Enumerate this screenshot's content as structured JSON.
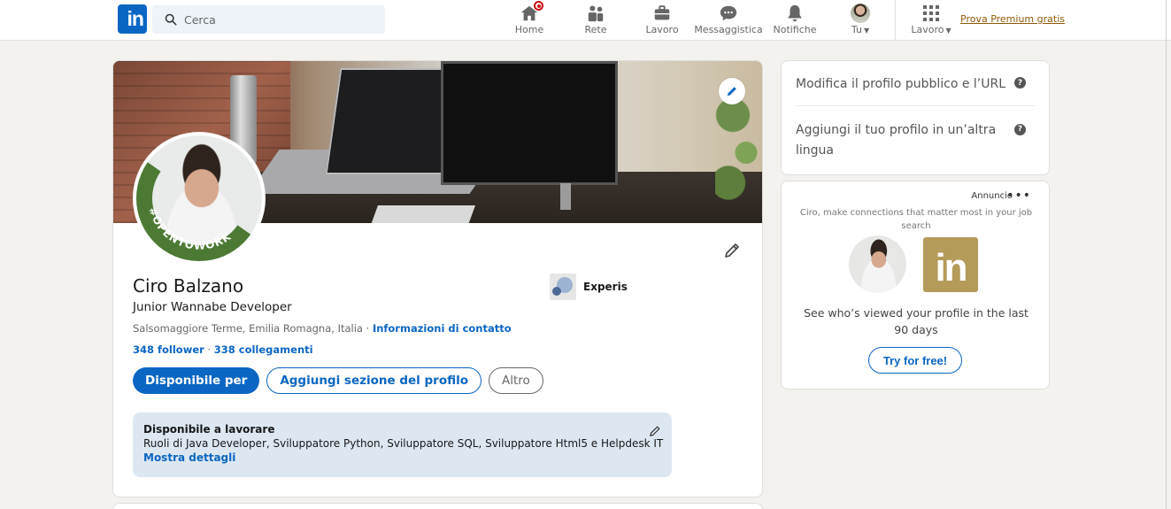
{
  "nav": {
    "search_placeholder": "Cerca",
    "items": [
      {
        "label": "Home",
        "icon": "home-icon"
      },
      {
        "label": "Rete",
        "icon": "network-icon"
      },
      {
        "label": "Lavoro",
        "icon": "briefcase-icon"
      },
      {
        "label": "Messaggistica",
        "icon": "messaging-icon"
      },
      {
        "label": "Notifiche",
        "icon": "bell-icon"
      },
      {
        "label": "Tu",
        "icon": "avatar"
      },
      {
        "label": "Lavoro",
        "icon": "grid-icon"
      }
    ],
    "premium_link": "Prova Premium gratis"
  },
  "profile": {
    "name": "Ciro Balzano",
    "headline": "Junior Wannabe Developer",
    "location": "Salsomaggiore Terme, Emilia Romagna, Italia",
    "location_sep": " · ",
    "contact_link": "Informazioni di contatto",
    "followers": "348 follower",
    "connections": "338 collegamenti",
    "connections_sep": " · ",
    "company": "Experis",
    "opentowork_badge": "#OPENTOWORK",
    "actions": {
      "primary": "Disponibile per",
      "add_section": "Aggiungi sezione del profilo",
      "more": "Altro"
    },
    "open_to_work": {
      "title": "Disponibile a lavorare",
      "roles": "Ruoli di Java Developer, Sviluppatore Python, Sviluppatore SQL, Sviluppatore Html5 e Helpdesk IT",
      "link": "Mostra dettagli"
    }
  },
  "sidebar": {
    "public_profile": "Modifica il profilo pubblico e l’URL",
    "other_language": "Aggiungi il tuo profilo in un’altra lingua",
    "help_glyph": "?"
  },
  "ad": {
    "label": "Annuncio",
    "menu_glyph": "•••",
    "subtitle": "Ciro, make connections that matter most in your job search",
    "logo_text": "in",
    "text": "See who’s viewed your profile in the last 90 days",
    "button": "Try for free!"
  },
  "colors": {
    "accent": "#0a66c2",
    "open_to_work_green": "#4c7a34",
    "premium_gold": "#915907",
    "ad_logo_gold": "#b59b5a"
  }
}
